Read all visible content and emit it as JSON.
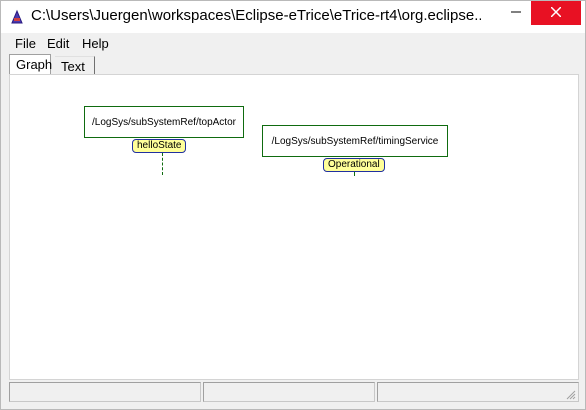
{
  "window": {
    "title": "C:\\Users\\Juergen\\workspaces\\Eclipse-eTrice\\eTrice-rt4\\org.eclipse...",
    "close_color": "#e81123"
  },
  "menu": {
    "items": [
      "File",
      "Edit",
      "Help"
    ]
  },
  "tabs": [
    {
      "label": "Graph",
      "selected": true
    },
    {
      "label": "Text",
      "selected": false
    }
  ],
  "graph": {
    "nodes": [
      {
        "path": "/LogSys/subSystemRef/topActor",
        "state": "helloState"
      },
      {
        "path": "/LogSys/subSystemRef/timingService",
        "state": "Operational"
      }
    ]
  },
  "icons": {
    "app": "etrice-app-icon",
    "minimize": "minimize-icon",
    "close": "close-icon",
    "resize": "resize-grip-icon"
  }
}
